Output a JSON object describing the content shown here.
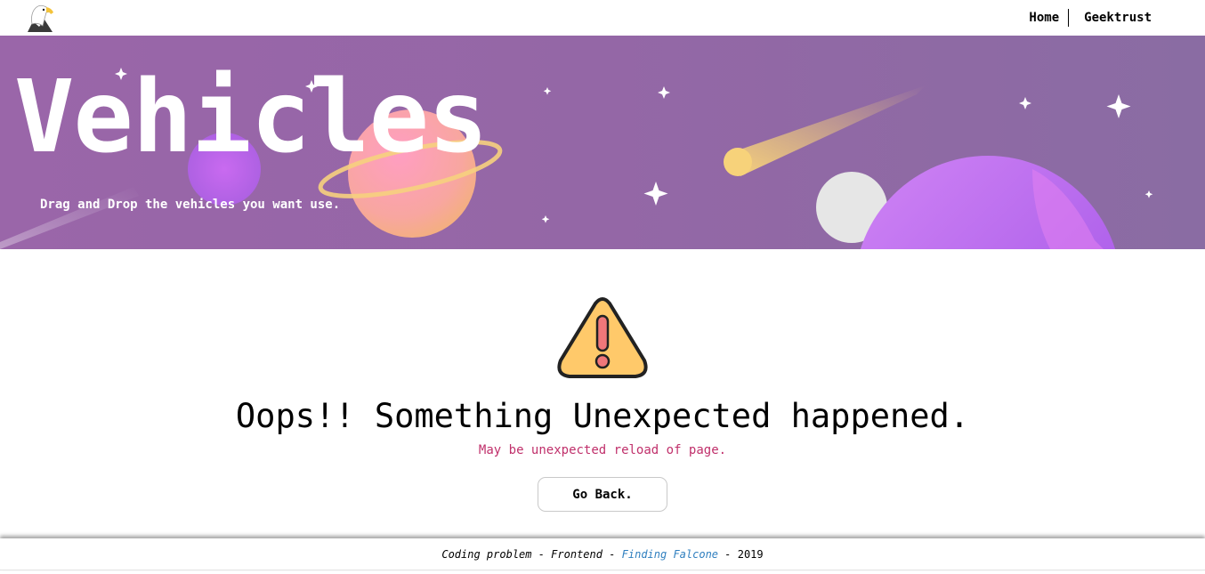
{
  "nav": {
    "home": "Home",
    "geektrust": "Geektrust"
  },
  "hero": {
    "title": "Vehicles",
    "subtitle": "Drag and Drop the vehicles you want use."
  },
  "error": {
    "title": "Oops!! Something Unexpected happened.",
    "message": "May be unexpected reload of page.",
    "back_button": "Go Back."
  },
  "footer": {
    "prefix": "Coding problem - Frontend - ",
    "link": "Finding Falcone",
    "mid": " - ",
    "year": "2019"
  },
  "icons": {
    "logo": "eagle-logo-icon",
    "warning": "warning-triangle-icon"
  },
  "colors": {
    "hero_bg": "#9467a6",
    "error_message": "#c0306b",
    "footer_link": "#2f7fbf",
    "warning_fill": "#ffc96a",
    "warning_mark": "#f0777a"
  }
}
